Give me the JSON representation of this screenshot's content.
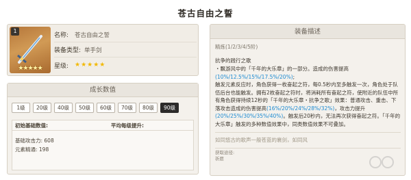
{
  "page": {
    "title": "苍古自由之誓"
  },
  "info": {
    "level_badge": "1",
    "thumb_stars": "★★★★★",
    "rows": [
      {
        "key": "名称:",
        "value": "苍古自由之誓"
      },
      {
        "key": "装备类型:",
        "value": "单手剑"
      },
      {
        "key": "星级:",
        "value": "★★★★★"
      }
    ]
  },
  "growth": {
    "title": "成长数值",
    "levels": [
      "1级",
      "20级",
      "40级",
      "50级",
      "60级",
      "70级",
      "80级",
      "90级"
    ],
    "active_level": "90级",
    "table": {
      "col1": "初始基础数值:",
      "col2": "平均每级提升:",
      "atk": "基础攻击力: 608",
      "em": "元素精通: 198"
    }
  },
  "desc": {
    "title": "装备描述",
    "refine": "精炼(1/2/3/4/5阶)",
    "skill_name": "抗争的践行之歌",
    "line1_pre": "・飘游风中的「千年的大乐章」的一部分。造成的伤害提高",
    "line1_hl": "(10%/12.5%/15%/17.5%/20%)",
    "line1_post": ";",
    "line2": "触发元素反应时，角色获得一枚奋起之符，每0.5秒内至多触发一次，角色处于队伍后台也能触发。拥有2枚奋起之符时，将消耗所有奋起之符，使附近的队伍中所有角色获得持续12秒的「千年的大乐章・抗争之歌」效果：普通攻击、重击、下落攻击造成的伤害提高",
    "line2_hl1": "(16%/20%/24%/28%/32%)",
    "line2_mid": "，攻击力提升",
    "line2_hl2": "(20%/25%/30%/35%/40%)",
    "line2_post": "。触发后20秒内，无法再次获得奋起之符。「千年的大乐章」触发的多种数值效果中，同类数值效果不可叠加。",
    "flavor": "如同悠古的歌声一般苍蓝的襄剑，如同风",
    "source_label": "获取途径:",
    "source_value": "祈愿"
  },
  "colors": {
    "highlight": "#1b8ad2",
    "active_btn": "#2c2b2a",
    "star": "#f2b800"
  }
}
